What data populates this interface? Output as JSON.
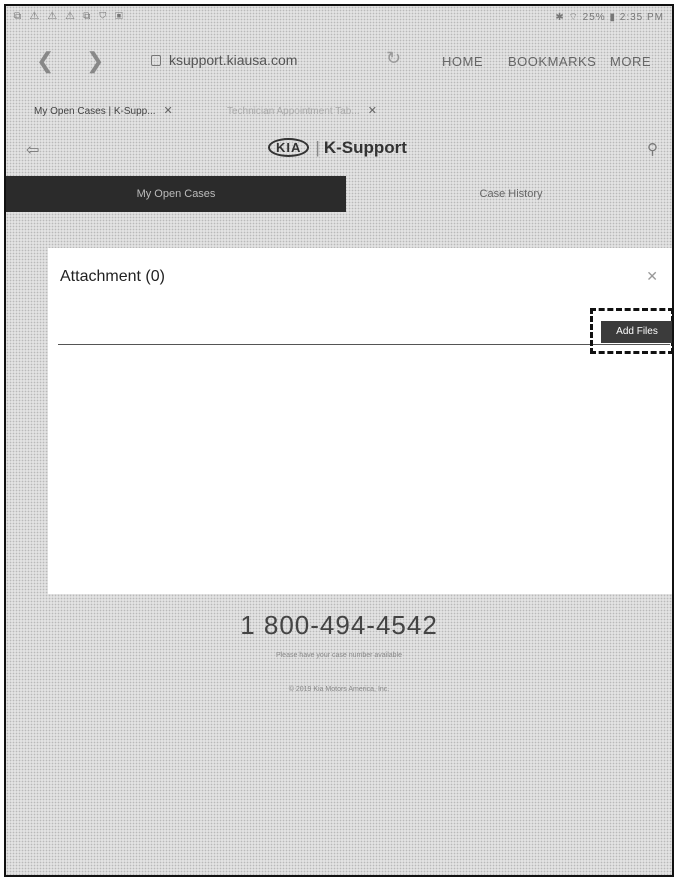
{
  "status_bar": {
    "left_icons": "⧉ ⚠ ⚠ ⚠ ⧉ ⛉ ▣",
    "right_status": "✱ ⌔ 25% ▮ 2:35 PM"
  },
  "browser": {
    "url": "ksupport.kiausa.com",
    "links": {
      "home": "HOME",
      "bookmarks": "BOOKMARKS",
      "more": "MORE"
    }
  },
  "tabs": [
    {
      "label": "My Open Cases | K-Supp..."
    },
    {
      "label": "Technician Appointment Tab..."
    }
  ],
  "header": {
    "logo": "KIA",
    "title": "K-Support"
  },
  "page_tabs": {
    "active": "My Open Cases",
    "inactive": "Case History"
  },
  "modal": {
    "title": "Attachment (0)",
    "add_files_label": "Add Files"
  },
  "footer": {
    "phone": "1 800-494-4542",
    "caption": "Please have your case number available",
    "copyright": "© 2019 Kia Motors America, Inc."
  }
}
